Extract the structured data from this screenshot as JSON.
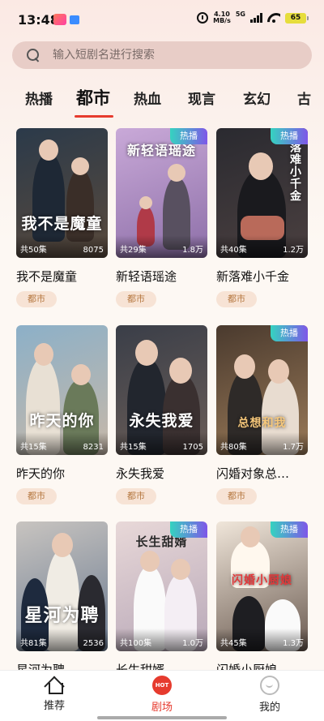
{
  "status": {
    "time": "13:48",
    "net_speed_top": "4.10",
    "net_speed_unit": "MB/s",
    "network": "5G",
    "battery": "65"
  },
  "search": {
    "placeholder": "输入短剧名进行搜索"
  },
  "tabs": [
    {
      "label": "热播"
    },
    {
      "label": "都市"
    },
    {
      "label": "热血"
    },
    {
      "label": "现言"
    },
    {
      "label": "玄幻"
    },
    {
      "label": "古"
    }
  ],
  "active_tab": "都市",
  "cards": [
    {
      "title": "我不是魔童",
      "poster_text": "我不是魔童",
      "episodes": "共50集",
      "views": "8075",
      "tag": "都市",
      "hot": "",
      "palette": [
        "#2b3a4a",
        "#5a4a3c"
      ]
    },
    {
      "title": "新轻语瑶途",
      "poster_text": "新轻语瑶途",
      "episodes": "共29集",
      "views": "1.8万",
      "tag": "都市",
      "hot": "热播",
      "palette": [
        "#c9a9d8",
        "#8d6fa8"
      ]
    },
    {
      "title": "新落难小千金",
      "poster_text": "落难小千金",
      "episodes": "共40集",
      "views": "1.2万",
      "tag": "都市",
      "hot": "热播",
      "palette": [
        "#2a2a30",
        "#4b4040"
      ]
    },
    {
      "title": "昨天的你",
      "poster_text": "昨天的你",
      "episodes": "共15集",
      "views": "8231",
      "tag": "都市",
      "hot": "",
      "palette": [
        "#8cb0c8",
        "#c7b8a8"
      ]
    },
    {
      "title": "永失我爱",
      "poster_text": "永失我爱",
      "episodes": "共15集",
      "views": "1705",
      "tag": "都市",
      "hot": "",
      "palette": [
        "#3a3e48",
        "#6b5e58"
      ]
    },
    {
      "title": "闪婚对象总…",
      "poster_text": "总想和我",
      "episodes": "共80集",
      "views": "1.7万",
      "tag": "都市",
      "hot": "热播",
      "palette": [
        "#4a3a2e",
        "#9a7a58"
      ]
    },
    {
      "title": "星河为聘",
      "poster_text": "星河为聘",
      "episodes": "共81集",
      "views": "2536",
      "tag": "都市",
      "hot": "",
      "palette": [
        "#c8c4c0",
        "#6a7a90"
      ]
    },
    {
      "title": "长生甜婿",
      "poster_text": "长生甜婿",
      "episodes": "共100集",
      "views": "1.0万",
      "tag": "都市",
      "hot": "热播",
      "palette": [
        "#e8d8d8",
        "#b8a8b8"
      ]
    },
    {
      "title": "闪婚小厨娘",
      "poster_text": "闪婚小厨娘",
      "episodes": "共45集",
      "views": "1.3万",
      "tag": "都市",
      "hot": "热播",
      "palette": [
        "#f0e6da",
        "#6a5a50"
      ]
    }
  ],
  "nav": [
    {
      "label": "推荐",
      "icon": "home-icon"
    },
    {
      "label": "剧场",
      "icon": "hot-icon",
      "badge": "HOT"
    },
    {
      "label": "我的",
      "icon": "profile-icon"
    }
  ]
}
